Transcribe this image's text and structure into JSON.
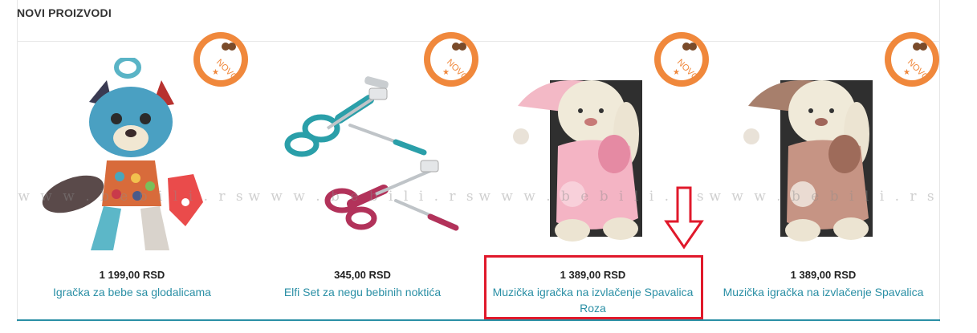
{
  "section": {
    "title": "NOVI PROIZVODI"
  },
  "watermark": "w w w . b e b i l i . r s",
  "badge": {
    "label": "NOVO"
  },
  "products": [
    {
      "price": "1 199,00 RSD",
      "name": "Igračka za bebe sa glodalicama",
      "image_icon": "raccoon-toy-icon"
    },
    {
      "price": "345,00 RSD",
      "name": "Elfi Set za negu bebinih noktića",
      "image_icon": "nail-care-set-icon"
    },
    {
      "price": "1 389,00 RSD",
      "name": "Muzička igračka na izvlačenje Spavalica Roza",
      "image_icon": "pink-bunny-toy-icon"
    },
    {
      "price": "1 389,00 RSD",
      "name": "Muzička igračka na izvlačenje Spavalica",
      "image_icon": "brown-bunny-toy-icon"
    }
  ],
  "colors": {
    "link": "#2a8fa5",
    "badge": "#f0883c",
    "highlight": "#e0192b"
  }
}
